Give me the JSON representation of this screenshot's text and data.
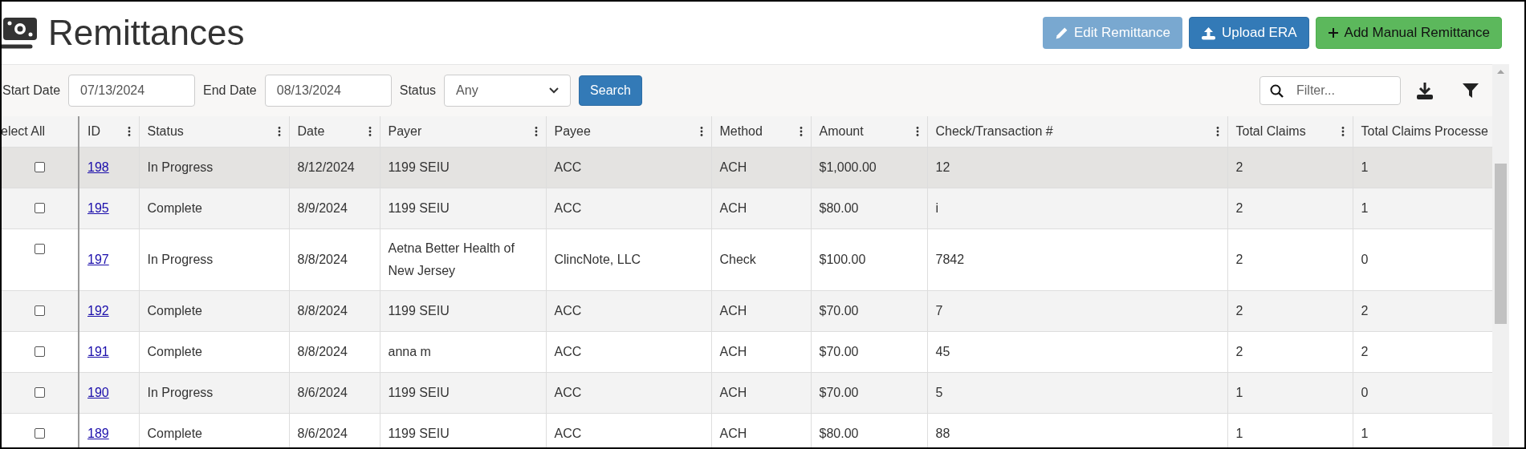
{
  "page": {
    "title": "Remittances"
  },
  "buttons": [
    {
      "label": "Edit Remittance",
      "kind": "edit",
      "disabled": true
    },
    {
      "label": "Upload ERA",
      "kind": "upload",
      "disabled": false
    },
    {
      "label": "Add Manual Remittance",
      "kind": "add",
      "disabled": false
    }
  ],
  "filters": {
    "start_date": {
      "label": "Start Date",
      "value": "07/13/2024"
    },
    "end_date": {
      "label": "End Date",
      "value": "08/13/2024"
    },
    "status": {
      "label": "Status",
      "value": "Any"
    },
    "search_button": "Search"
  },
  "filter_box": {
    "placeholder": "Filter..."
  },
  "table": {
    "columns": [
      {
        "label": "elect All",
        "menu": false
      },
      {
        "label": "ID",
        "menu": true
      },
      {
        "label": "Status",
        "menu": true
      },
      {
        "label": "Date",
        "menu": true
      },
      {
        "label": "Payer",
        "menu": true
      },
      {
        "label": "Payee",
        "menu": true
      },
      {
        "label": "Method",
        "menu": true
      },
      {
        "label": "Amount",
        "menu": true
      },
      {
        "label": "Check/Transaction #",
        "menu": true
      },
      {
        "label": "Total Claims",
        "menu": true
      },
      {
        "label": "Total Claims Processe",
        "menu": false
      }
    ],
    "rows": [
      {
        "checked": false,
        "hovered": true,
        "cells": [
          "",
          "198",
          "In Progress",
          "8/12/2024",
          "1199 SEIU",
          "ACC",
          "ACH",
          "$1,000.00",
          "12",
          "2",
          "1"
        ]
      },
      {
        "checked": false,
        "hovered": false,
        "cells": [
          "",
          "195",
          "Complete",
          "8/9/2024",
          "1199 SEIU",
          "ACC",
          "ACH",
          "$80.00",
          "i",
          "2",
          "1"
        ]
      },
      {
        "checked": false,
        "hovered": false,
        "cells": [
          "",
          "197",
          "In Progress",
          "8/8/2024",
          "Aetna Better Health of New Jersey",
          "ClincNote, LLC",
          "Check",
          "$100.00",
          "7842",
          "2",
          "0"
        ]
      },
      {
        "checked": false,
        "hovered": false,
        "cells": [
          "",
          "192",
          "Complete",
          "8/8/2024",
          "1199 SEIU",
          "ACC",
          "ACH",
          "$70.00",
          "7",
          "2",
          "2"
        ]
      },
      {
        "checked": false,
        "hovered": false,
        "cells": [
          "",
          "191",
          "Complete",
          "8/8/2024",
          "anna m",
          "ACC",
          "ACH",
          "$70.00",
          "45",
          "2",
          "2"
        ]
      },
      {
        "checked": false,
        "hovered": false,
        "cells": [
          "",
          "190",
          "In Progress",
          "8/6/2024",
          "1199 SEIU",
          "ACC",
          "ACH",
          "$70.00",
          "5",
          "1",
          "0"
        ]
      },
      {
        "checked": false,
        "hovered": false,
        "cells": [
          "",
          "189",
          "Complete",
          "8/6/2024",
          "1199 SEIU",
          "ACC",
          "ACH",
          "$80.00",
          "88",
          "1",
          "1"
        ]
      }
    ]
  }
}
